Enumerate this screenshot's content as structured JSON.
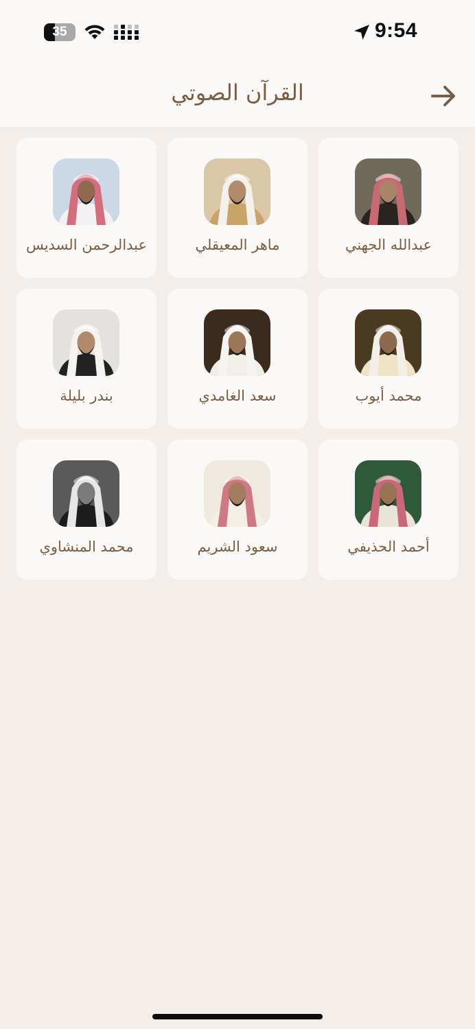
{
  "status_bar": {
    "battery_level": "35",
    "battery_fill_percent": 35,
    "time": "9:54"
  },
  "header": {
    "title": "القرآن الصوتي",
    "back_icon": "arrow-right-icon"
  },
  "reciters": [
    {
      "name": "عبدالله الجهني",
      "photo_bg": "#6f6a5a",
      "ghutra": "#c86a72",
      "skin": "#a98468",
      "robe": "#2a2420"
    },
    {
      "name": "ماهر المعيقلي",
      "photo_bg": "#d9c7a8",
      "ghutra": "#f4f1ec",
      "skin": "#b38a6c",
      "robe": "#c8a36a"
    },
    {
      "name": "عبدالرحمن السديس",
      "photo_bg": "#cdd8e6",
      "ghutra": "#d46e7e",
      "skin": "#8f6950",
      "robe": "#f2f2f2"
    },
    {
      "name": "محمد أيوب",
      "photo_bg": "#4a3a22",
      "ghutra": "#f2efe8",
      "skin": "#8c6a50",
      "robe": "#efe4c8"
    },
    {
      "name": "سعد الغامدي",
      "photo_bg": "#3b2a1e",
      "ghutra": "#f6f4f0",
      "skin": "#9b7658",
      "robe": "#f0efe9"
    },
    {
      "name": "بندر بليلة",
      "photo_bg": "#e4e2de",
      "ghutra": "#f5f3ef",
      "skin": "#b08a6a",
      "robe": "#222222"
    },
    {
      "name": "أحمد الحذيفي",
      "photo_bg": "#2f5a3a",
      "ghutra": "#c9687a",
      "skin": "#9a7356",
      "robe": "#e9e4d9"
    },
    {
      "name": "سعود الشريم",
      "photo_bg": "#efe9e0",
      "ghutra": "#d07883",
      "skin": "#a37d60",
      "robe": "#f3efe6"
    },
    {
      "name": "محمد المنشاوي",
      "photo_bg": "#5a5a5a",
      "ghutra": "#e6e6e6",
      "skin": "#7b7b7b",
      "robe": "#1c1c1c"
    }
  ]
}
